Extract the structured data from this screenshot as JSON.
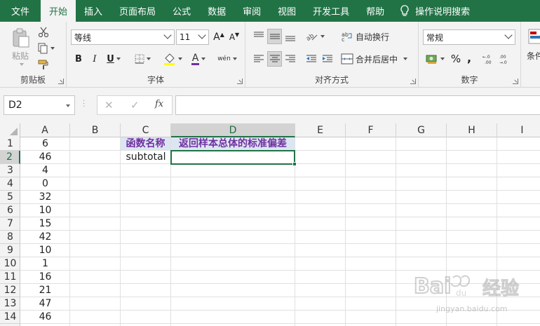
{
  "tabs": [
    "文件",
    "开始",
    "插入",
    "页面布局",
    "公式",
    "数据",
    "审阅",
    "视图",
    "开发工具",
    "帮助"
  ],
  "active_tab_index": 1,
  "tell_me": "操作说明搜索",
  "ribbon": {
    "clipboard": {
      "label": "剪贴板",
      "paste": "粘贴"
    },
    "font": {
      "label": "字体",
      "font_name": "等线",
      "font_size": "11",
      "bold": "B",
      "italic": "I",
      "underline": "U",
      "grow": "A",
      "shrink": "A",
      "font_color": "A",
      "phonetic": "wén"
    },
    "alignment": {
      "label": "对齐方式",
      "wrap_text": "自动换行",
      "merge_center": "合并后居中"
    },
    "number": {
      "label": "数字",
      "format": "常规",
      "percent": "%",
      "comma": ","
    },
    "styles": {
      "conditional": "条件"
    }
  },
  "formula_bar": {
    "name_box": "D2",
    "fx": "fx",
    "cancel": "✕",
    "enter": "✓",
    "content": ""
  },
  "columns": [
    "A",
    "B",
    "C",
    "D",
    "E",
    "F",
    "G",
    "H",
    "I"
  ],
  "active_column": "D",
  "active_row": 2,
  "rows": [
    1,
    2,
    3,
    4,
    5,
    6,
    7,
    8,
    9,
    10,
    11,
    12,
    13,
    14
  ],
  "column_a": [
    "6",
    "46",
    "4",
    "0",
    "32",
    "10",
    "15",
    "42",
    "10",
    "1",
    "16",
    "21",
    "47",
    "46"
  ],
  "cells": {
    "C1": "函数名称",
    "D1": "返回样本总体的标准偏差",
    "C2": "subtotal"
  },
  "colors": {
    "accent": "#217346",
    "header_fill": "#dce6f2",
    "header_text": "#7030a0"
  },
  "watermark": {
    "brand": "Baidu 经验",
    "url": "jingyan.baidu.com"
  }
}
